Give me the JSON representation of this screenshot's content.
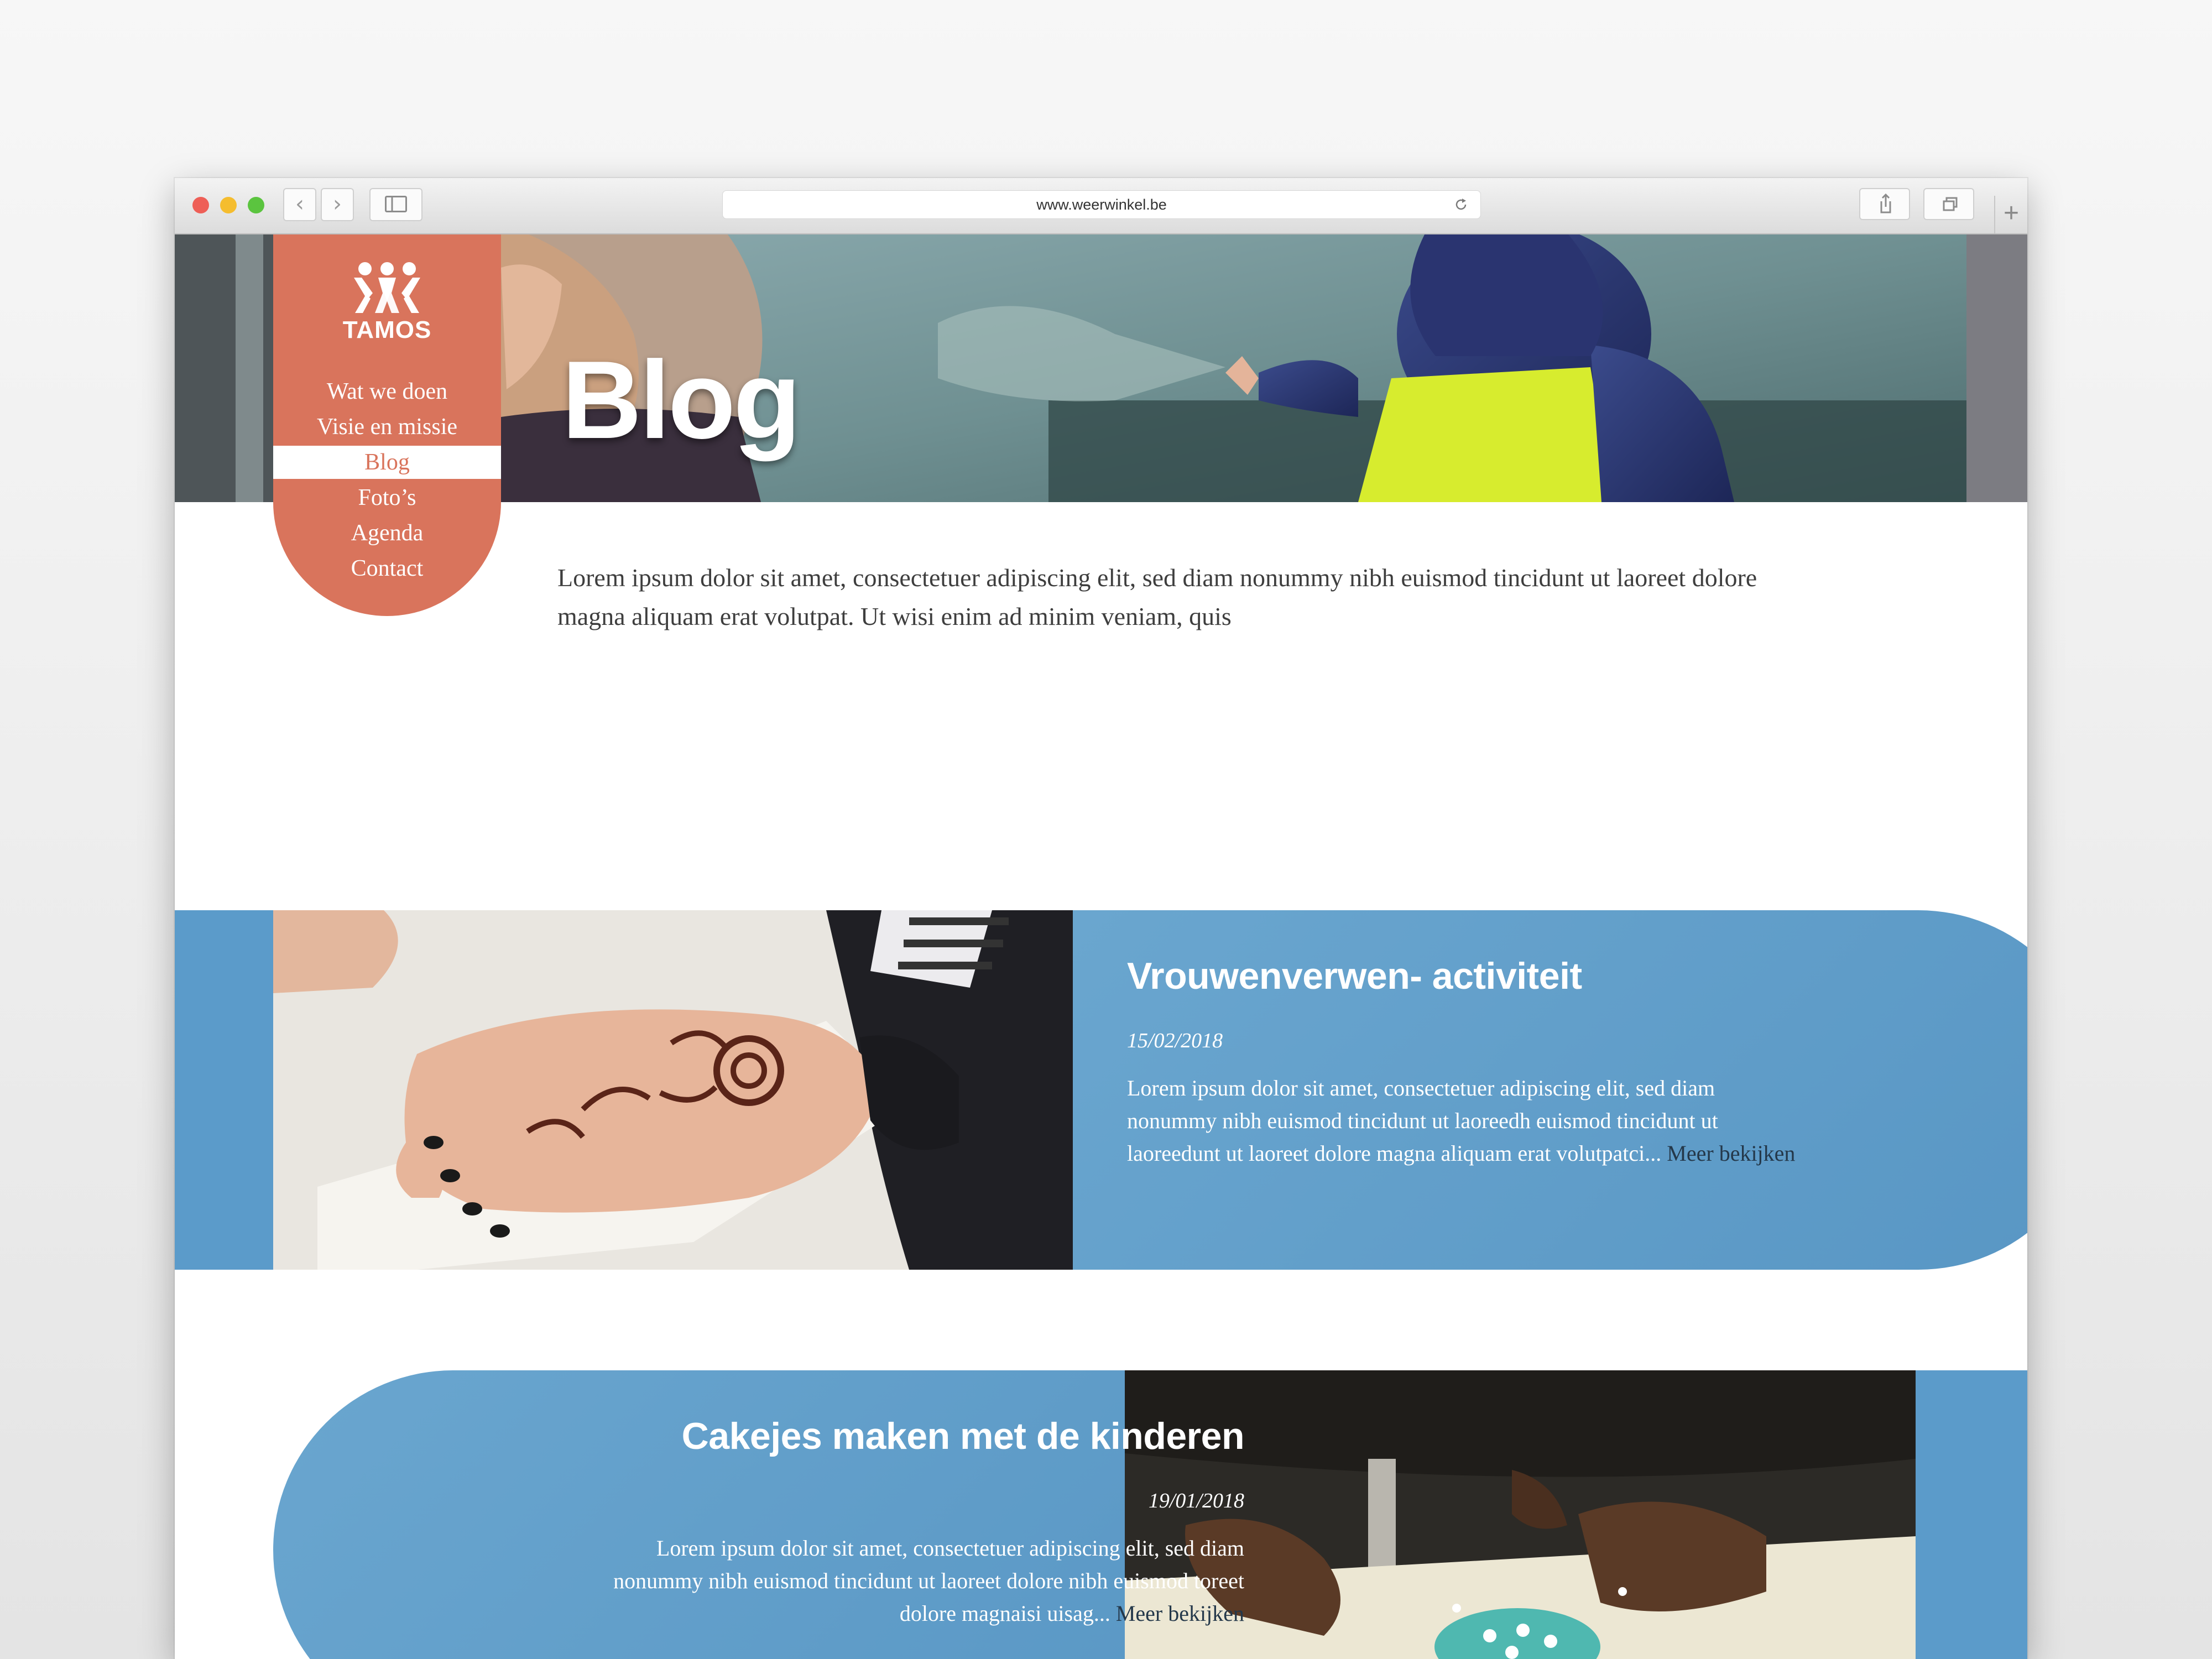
{
  "browser": {
    "url": "www.weerwinkel.be",
    "back_icon": "‹",
    "forward_icon": "›",
    "new_tab_icon": "+",
    "traffic_lights": [
      "#ee5f57",
      "#f5bd2f",
      "#5bc43f"
    ]
  },
  "site": {
    "logo_text": "TAMOS",
    "nav": [
      "Wat we doen",
      "Visie en missie",
      "Blog",
      "Foto’s",
      "Agenda",
      "Contact"
    ],
    "active_nav": "Blog",
    "accent": "#d9745c",
    "blue": "#5b9bca"
  },
  "hero": {
    "title": "Blog"
  },
  "intro": {
    "text": "Lorem ipsum dolor sit amet, consectetuer adipiscing elit, sed diam nonummy nibh euismod tincidunt ut laoreet dolore magna aliquam erat volutpat. Ut wisi enim ad minim veniam, quis"
  },
  "posts": [
    {
      "title": "Vrouwenverwen- activiteit",
      "date": "15/02/2018",
      "excerpt": "Lorem ipsum dolor sit amet, consectetuer adipiscing elit, sed diam nonummy nibh euismod tincidunt ut laoreedh euismod tincidunt ut laoreedunt ut laoreet dolore magna aliquam erat volutpatci...",
      "more": "Meer bekijken"
    },
    {
      "title": "Cakejes maken met de kinderen",
      "date": "19/01/2018",
      "excerpt": "Lorem ipsum dolor sit amet, consectetuer adipiscing elit, sed diam nonummy nibh euismod tincidunt ut laoreet dolore nibh euismod toreet dolore magnaisi uisag...",
      "more": "Meer bekijken"
    }
  ]
}
